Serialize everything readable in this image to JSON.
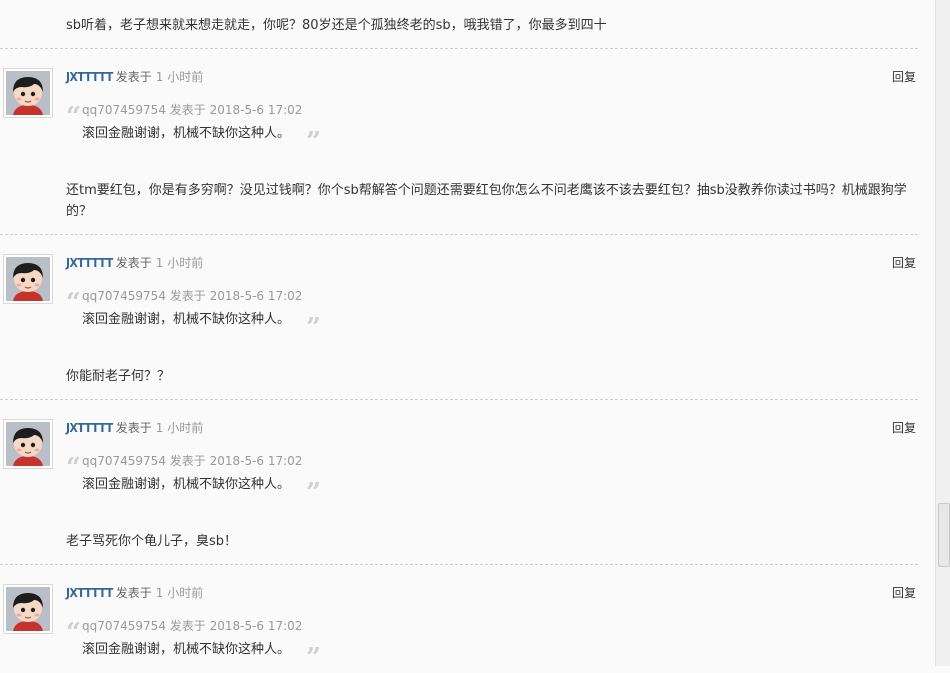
{
  "top_message": "sb听着，老子想来就来想走就走，你呢？80岁还是个孤独终老的sb，哦我错了，你最多到四十",
  "reply_label": "回复",
  "posted_label": "发表于",
  "posts": [
    {
      "author": "JXTTTTT",
      "time": "1 小时前",
      "quote_author_line": "qq707459754 发表于 2018-5-6 17:02",
      "quote_text": "滚回金融谢谢，机械不缺你这种人。",
      "message": "还tm要红包，你是有多穷啊？没见过钱啊？你个sb帮解答个问题还需要红包你怎么不问老鹰该不该去要红包？抽sb没教养你读过书吗？机械跟狗学的？"
    },
    {
      "author": "JXTTTTT",
      "time": "1 小时前",
      "quote_author_line": "qq707459754 发表于 2018-5-6 17:02",
      "quote_text": "滚回金融谢谢，机械不缺你这种人。",
      "message": "你能耐老子何？？"
    },
    {
      "author": "JXTTTTT",
      "time": "1 小时前",
      "quote_author_line": "qq707459754 发表于 2018-5-6 17:02",
      "quote_text": "滚回金融谢谢，机械不缺你这种人。",
      "message": "老子骂死你个龟儿子，臭sb！"
    },
    {
      "author": "JXTTTTT",
      "time": "1 小时前",
      "quote_author_line": "qq707459754 发表于 2018-5-6 17:02",
      "quote_text": "滚回金融谢谢，机械不缺你这种人。",
      "message": ""
    }
  ],
  "icons": {
    "quote_open": "quote-open-icon",
    "quote_close": "quote-close-icon",
    "avatar": "cartoon-avatar"
  }
}
